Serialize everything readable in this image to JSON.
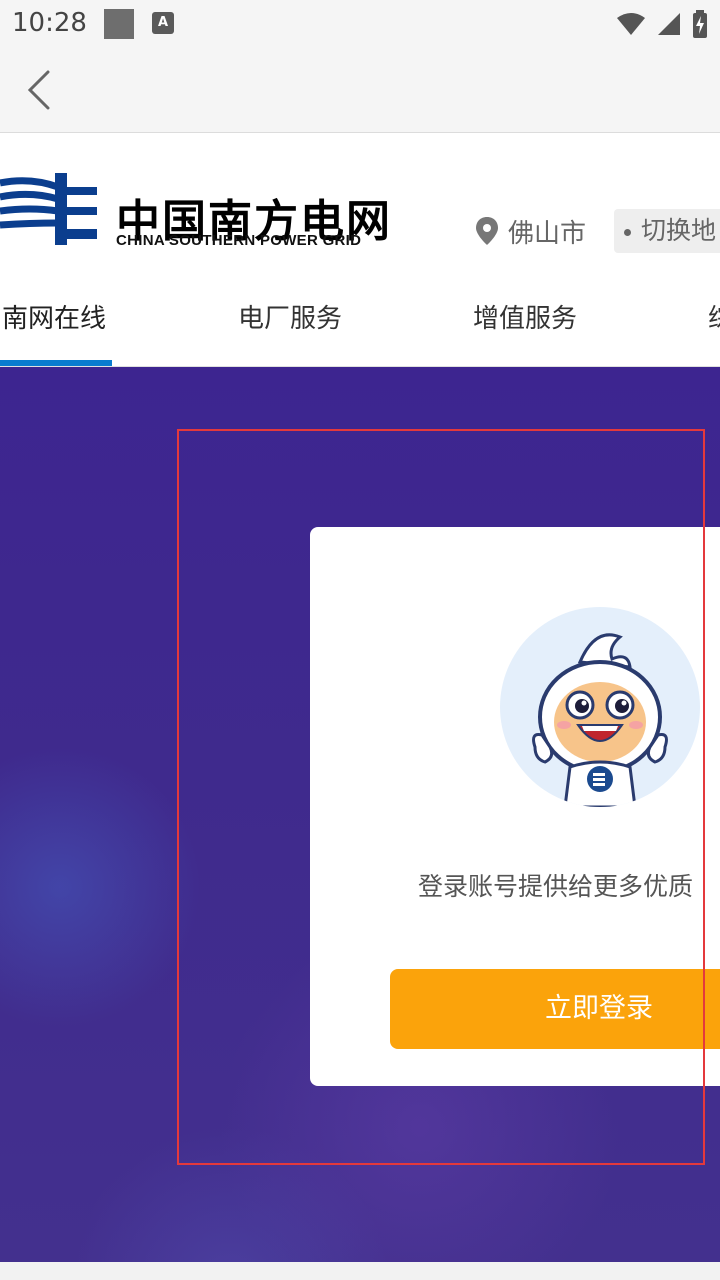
{
  "status_bar": {
    "time": "10:28",
    "icons": [
      "notification-square-icon",
      "a-keyboard-icon",
      "wifi-icon",
      "signal-icon",
      "battery-charging-icon"
    ]
  },
  "navbar": {
    "back_icon": "chevron-left-icon"
  },
  "header": {
    "logo_cn": "中国南方电网",
    "logo_en": "CHINA SOUTHERN POWER GRID",
    "city": "佛山市",
    "switch_label": "切换地"
  },
  "tabs": [
    {
      "label": "南网在线",
      "active": true
    },
    {
      "label": "电厂服务",
      "active": false
    },
    {
      "label": "增值服务",
      "active": false
    },
    {
      "label": "综",
      "active": false
    }
  ],
  "login_card": {
    "promo_text": "登录账号提供给更多优质",
    "login_button": "立即登录",
    "mascot_icon": "mascot-avatar"
  },
  "colors": {
    "accent_blue": "#0a7ccf",
    "button_orange": "#fba30b",
    "hero_purple": "#3f2a8d",
    "highlight_red": "#e4393c"
  }
}
